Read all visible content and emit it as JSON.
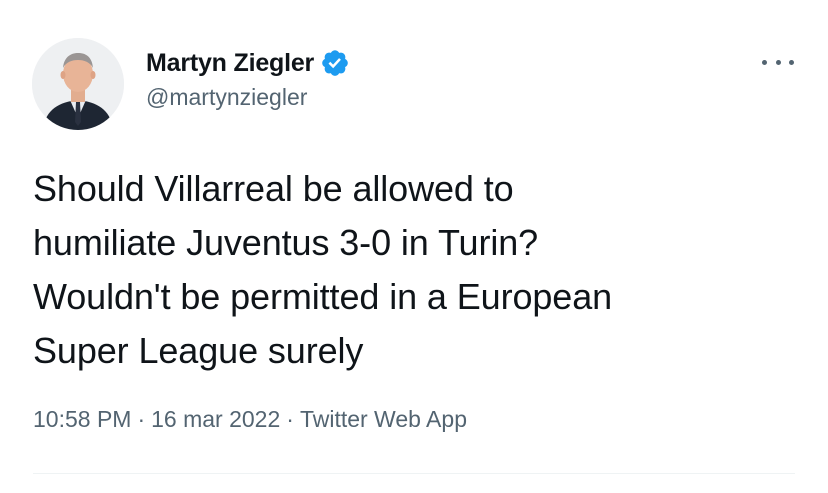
{
  "author": {
    "display_name": "Martyn Ziegler",
    "handle": "@martynziegler",
    "verified": true
  },
  "tweet": {
    "lines": [
      "Should Villarreal be allowed to",
      "humiliate Juventus 3-0 in Turin?",
      "Wouldn't be permitted in a European",
      "Super League surely"
    ]
  },
  "meta": {
    "time": "10:58 PM",
    "separator": "·",
    "date": "16 mar 2022",
    "source": "Twitter Web App"
  },
  "icons": {
    "verified": "verified-badge-icon",
    "more": "more-options-icon"
  },
  "colors": {
    "verified_blue": "#1d9bf0",
    "secondary_text": "#536471",
    "primary_text": "#0f1419"
  }
}
